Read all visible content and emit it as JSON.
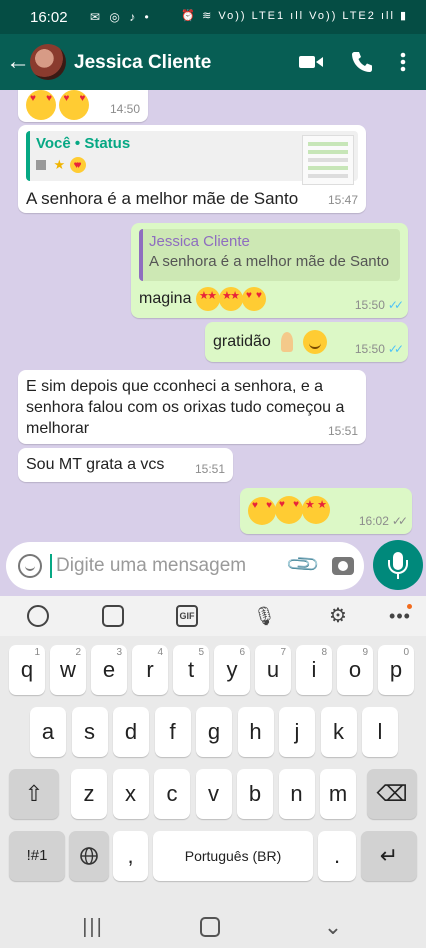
{
  "status_bar": {
    "time": "16:02",
    "left_icons": "✉ ◎ ♪ •",
    "right_icons": "⏰ ≋ Vo)) LTE1 ıll Vo)) LTE2 ıll ▮"
  },
  "header": {
    "contact_name": "Jessica Cliente",
    "icons": [
      "back-arrow-icon",
      "avatar",
      "video-call-icon",
      "phone-icon",
      "menu-icon"
    ]
  },
  "messages": [
    {
      "id": "m1",
      "direction": "in",
      "emoji": [
        "heart-eyes",
        "heart-eyes"
      ],
      "time": "14:50"
    },
    {
      "id": "m2",
      "direction": "in",
      "quote_author": "Você • Status",
      "text": "A senhora é a melhor mãe de Santo",
      "time": "15:47"
    },
    {
      "id": "m3",
      "direction": "out",
      "quote_author": "Jessica Cliente",
      "quote_text": "A senhora é a melhor mãe de Santo",
      "text": "magina",
      "emoji": [
        "star-eyes",
        "star-eyes",
        "heart-eyes"
      ],
      "time": "15:50"
    },
    {
      "id": "m4",
      "direction": "out",
      "text": "gratidão",
      "emoji": [
        "folded-hands",
        "smile"
      ],
      "time": "15:50"
    },
    {
      "id": "m5",
      "direction": "in",
      "text": "E sim depois que cconheci a senhora, e a senhora falou com os orixas tudo começou a melhorar",
      "time": "15:51"
    },
    {
      "id": "m6",
      "direction": "in",
      "text": "Sou MT grata a vcs",
      "time": "15:51"
    },
    {
      "id": "m7",
      "direction": "out",
      "emoji": [
        "heart-eyes",
        "heart-eyes",
        "star-eyes"
      ],
      "time": "16:02"
    }
  ],
  "composer": {
    "placeholder": "Digite uma mensagem"
  },
  "keyboard": {
    "row1": [
      {
        "k": "q",
        "s": "1"
      },
      {
        "k": "w",
        "s": "2"
      },
      {
        "k": "e",
        "s": "3"
      },
      {
        "k": "r",
        "s": "4"
      },
      {
        "k": "t",
        "s": "5"
      },
      {
        "k": "y",
        "s": "6"
      },
      {
        "k": "u",
        "s": "7"
      },
      {
        "k": "i",
        "s": "8"
      },
      {
        "k": "o",
        "s": "9"
      },
      {
        "k": "p",
        "s": "0"
      }
    ],
    "row2": [
      "a",
      "s",
      "d",
      "f",
      "g",
      "h",
      "j",
      "k",
      "l"
    ],
    "row3": [
      "z",
      "x",
      "c",
      "v",
      "b",
      "n",
      "m"
    ],
    "symbols_label": "!#1",
    "comma_label": ",",
    "space_label": "Português (BR)",
    "period_label": ".",
    "shift_glyph": "⇧",
    "backspace_glyph": "⌫",
    "enter_glyph": "↵",
    "globe_glyph": "🌐"
  },
  "colors": {
    "header": "#075e54",
    "chat_background": "#d8cfe9",
    "outgoing_bubble": "#dcf8c6",
    "read_ticks": "#4fc3f7",
    "mic_button": "#00897b"
  }
}
